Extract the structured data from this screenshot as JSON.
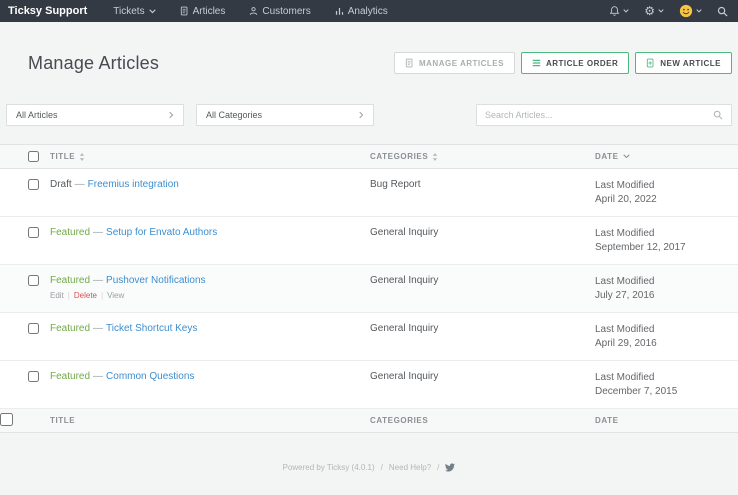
{
  "navbar": {
    "brand": "Ticksy Support",
    "items": [
      {
        "label": "Tickets"
      },
      {
        "label": "Articles"
      },
      {
        "label": "Customers"
      },
      {
        "label": "Analytics"
      }
    ]
  },
  "icons": {
    "gear": "⚙"
  },
  "header": {
    "title": "Manage Articles",
    "manage_articles_label": "MANAGE ARTICLES",
    "article_order_label": "ARTICLE ORDER",
    "new_article_label": "NEW ARTICLE"
  },
  "filters": {
    "articles": "All Articles",
    "categories": "All Categories",
    "search_placeholder": "Search Articles..."
  },
  "table": {
    "separator": "—",
    "action_separator": "|",
    "headers": {
      "title": "TITLE",
      "categories": "CATEGORIES",
      "date": "DATE"
    },
    "rows": [
      {
        "prefix": "Draft",
        "title": "Freemius integration",
        "category": "Bug Report",
        "modified": "Last Modified",
        "date": "April 20, 2022"
      },
      {
        "prefix": "Featured",
        "title": "Setup for Envato Authors",
        "category": "General Inquiry",
        "modified": "Last Modified",
        "date": "September 12, 2017"
      },
      {
        "prefix": "Featured",
        "title": "Pushover Notifications",
        "category": "General Inquiry",
        "modified": "Last Modified",
        "date": "July 27, 2016",
        "actions": {
          "edit": "Edit",
          "delete": "Delete",
          "view": "View"
        }
      },
      {
        "prefix": "Featured",
        "title": "Ticket Shortcut Keys",
        "category": "General Inquiry",
        "modified": "Last Modified",
        "date": "April 29, 2016"
      },
      {
        "prefix": "Featured",
        "title": "Common Questions",
        "category": "General Inquiry",
        "modified": "Last Modified",
        "date": "December 7, 2015"
      }
    ]
  },
  "footer": {
    "powered": "Powered by Ticksy (4.0.1)",
    "sep": "/",
    "help": "Need Help?"
  },
  "colors": {
    "navbar_bg": "#333a43",
    "accent_green": "#4cb97f",
    "featured_green": "#72a94a",
    "link_blue": "#3d8ed0",
    "delete_red": "#d9534f",
    "page_bg": "#f3f4f4"
  }
}
